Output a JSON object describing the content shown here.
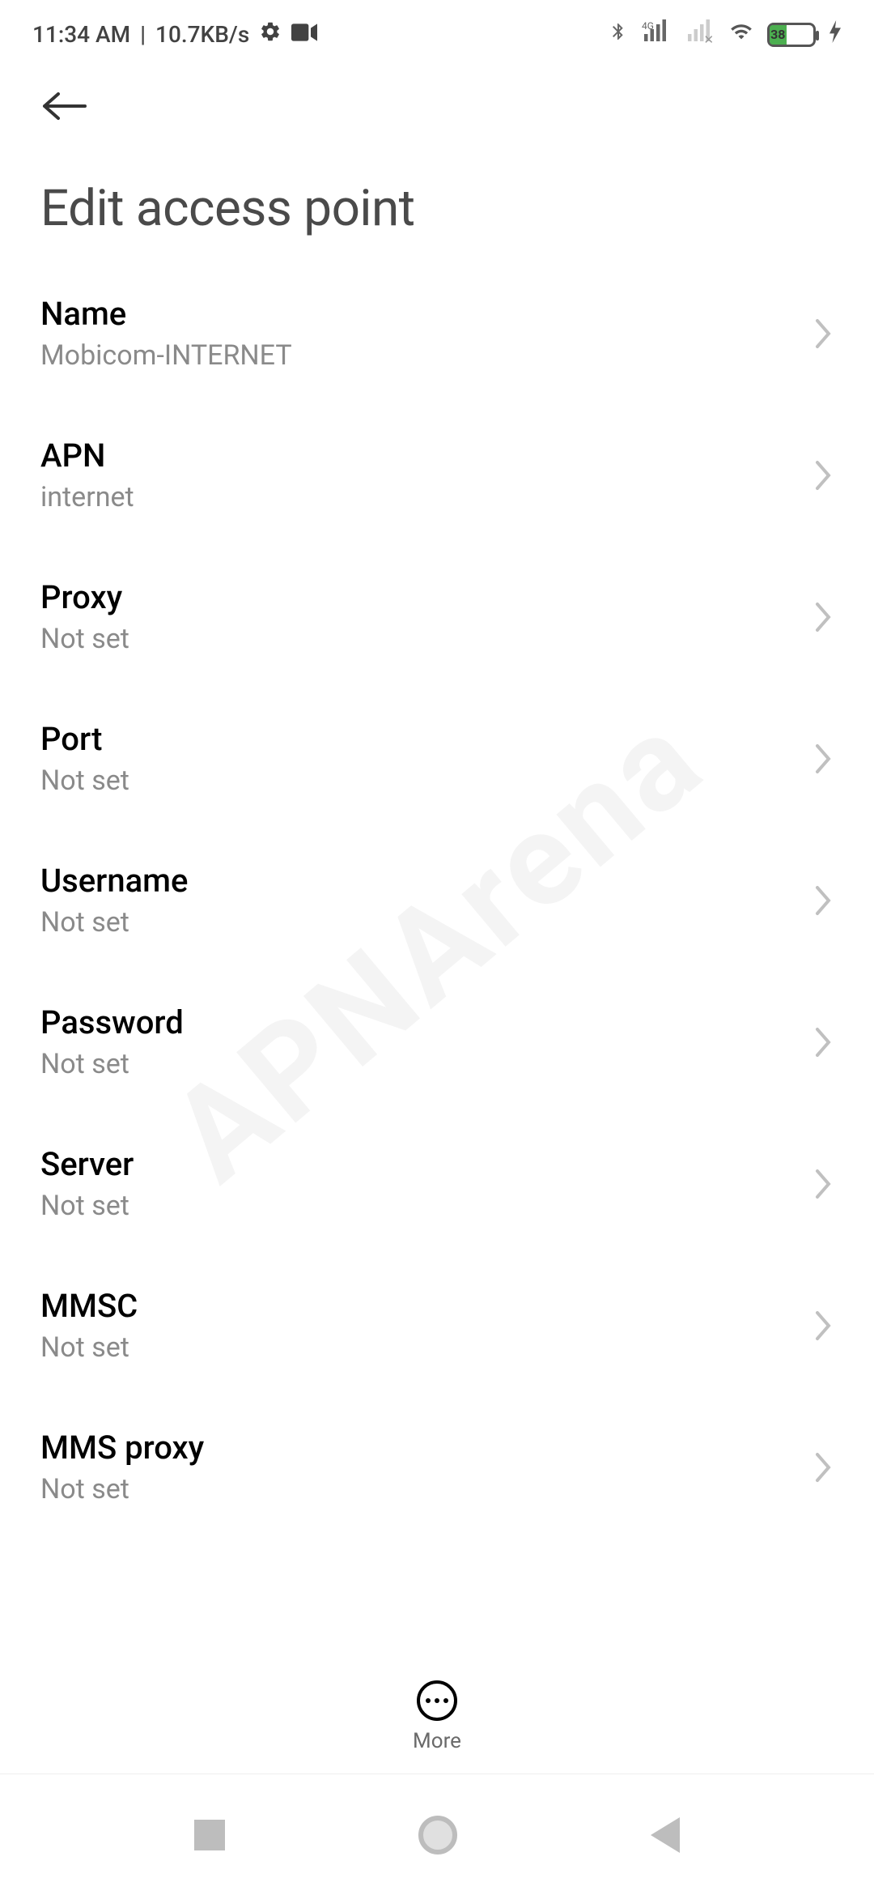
{
  "status_bar": {
    "time": "11:34 AM",
    "separator": "|",
    "speed": "10.7KB/s",
    "battery_percent": "38"
  },
  "header": {
    "title": "Edit access point"
  },
  "settings": [
    {
      "id": "name",
      "label": "Name",
      "value": "Mobicom-INTERNET"
    },
    {
      "id": "apn",
      "label": "APN",
      "value": "internet"
    },
    {
      "id": "proxy",
      "label": "Proxy",
      "value": "Not set"
    },
    {
      "id": "port",
      "label": "Port",
      "value": "Not set"
    },
    {
      "id": "username",
      "label": "Username",
      "value": "Not set"
    },
    {
      "id": "password",
      "label": "Password",
      "value": "Not set"
    },
    {
      "id": "server",
      "label": "Server",
      "value": "Not set"
    },
    {
      "id": "mmsc",
      "label": "MMSC",
      "value": "Not set"
    },
    {
      "id": "mms-proxy",
      "label": "MMS proxy",
      "value": "Not set"
    }
  ],
  "bottom_action": {
    "more_label": "More"
  },
  "watermark": "APNArena"
}
